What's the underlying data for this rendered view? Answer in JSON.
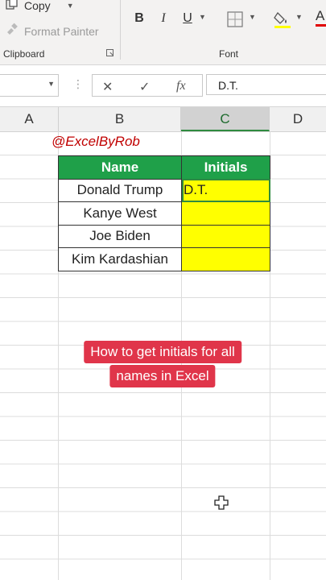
{
  "ribbon": {
    "copy_label": "Copy",
    "format_painter_label": "Format Painter",
    "clipboard_group": "Clipboard",
    "font_group": "Font",
    "bold": "B",
    "italic": "I",
    "underline": "U",
    "font_color": "A"
  },
  "formula_bar": {
    "cancel_icon": "✕",
    "enter_icon": "✓",
    "fx_icon": "fx",
    "value": "D.T."
  },
  "columns": [
    "A",
    "B",
    "C",
    "D"
  ],
  "handle": "@ExcelByRob",
  "table": {
    "headers": [
      "Name",
      "Initials"
    ],
    "rows": [
      {
        "name": "Donald Trump",
        "initials": "D.T."
      },
      {
        "name": "Kanye West",
        "initials": ""
      },
      {
        "name": "Joe Biden",
        "initials": ""
      },
      {
        "name": "Kim Kardashian",
        "initials": ""
      }
    ]
  },
  "banner": {
    "line1": "How to get initials for all",
    "line2": "names in Excel"
  },
  "colors": {
    "header_green": "#1fa049",
    "initials_yellow": "#ffff00",
    "handle_red": "#c00000",
    "banner_red": "#e0354a"
  }
}
